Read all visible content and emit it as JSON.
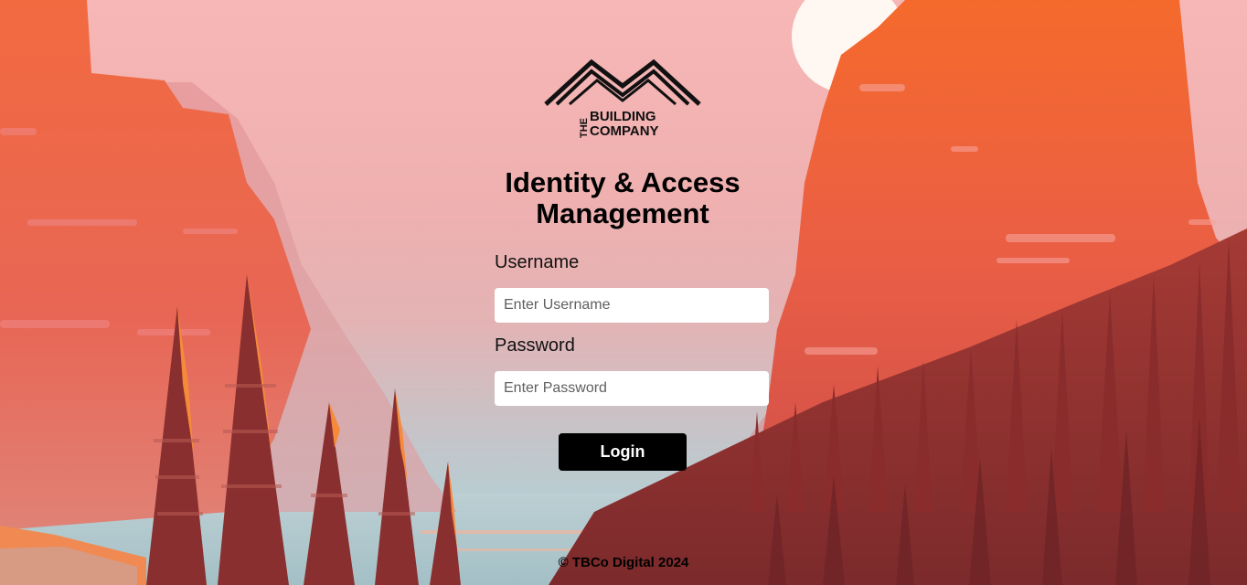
{
  "brand": {
    "logo_the": "THE",
    "logo_line1": "BUILDING",
    "logo_line2": "COMPANY"
  },
  "login": {
    "title": "Identity & Access Management",
    "username_label": "Username",
    "username_placeholder": "Enter Username",
    "username_value": "",
    "password_label": "Password",
    "password_placeholder": "Enter Password",
    "password_value": "",
    "submit_label": "Login"
  },
  "footer": {
    "copyright": "© TBCo Digital 2024"
  },
  "colors": {
    "button_bg": "#000000",
    "button_text": "#ffffff",
    "sky_top": "#f7b7b6",
    "cliff_orange": "#f0663a",
    "forest_dark": "#8e2f2e"
  }
}
